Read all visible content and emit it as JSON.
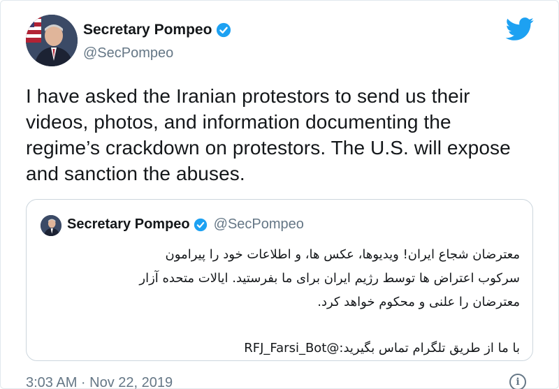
{
  "tweet": {
    "author": {
      "display_name": "Secretary Pompeo",
      "handle": "@SecPompeo",
      "verified": true,
      "avatar_icon": "profile-photo-with-flag"
    },
    "text": "I have asked the Iranian protestors to send us their videos, photos, and information documenting the regime’s crackdown on protestors. The U.S. will expose and sanction the abuses.",
    "timestamp": "3:03 AM · Nov 22, 2019",
    "brand_icon": "twitter-bird-icon",
    "brand_color": "#1da1f2",
    "info_icon": "info-icon"
  },
  "quoted_tweet": {
    "author": {
      "display_name": "Secretary Pompeo",
      "handle": "@SecPompeo",
      "verified": true
    },
    "lines": [
      "معترضان شجاع ایران! ویدیوها، عکس ها، و اطلاعات خود را پیرامون",
      "سرکوب اعتراض ها توسط رژیم ایران برای ما بفرستید. ایالات متحده آزار",
      "معترضان را علنی و محکوم خواهد کرد."
    ],
    "contact_line": "با ما از طریق تلگرام تماس بگیرید:@RFJ_Farsi_Bot"
  }
}
